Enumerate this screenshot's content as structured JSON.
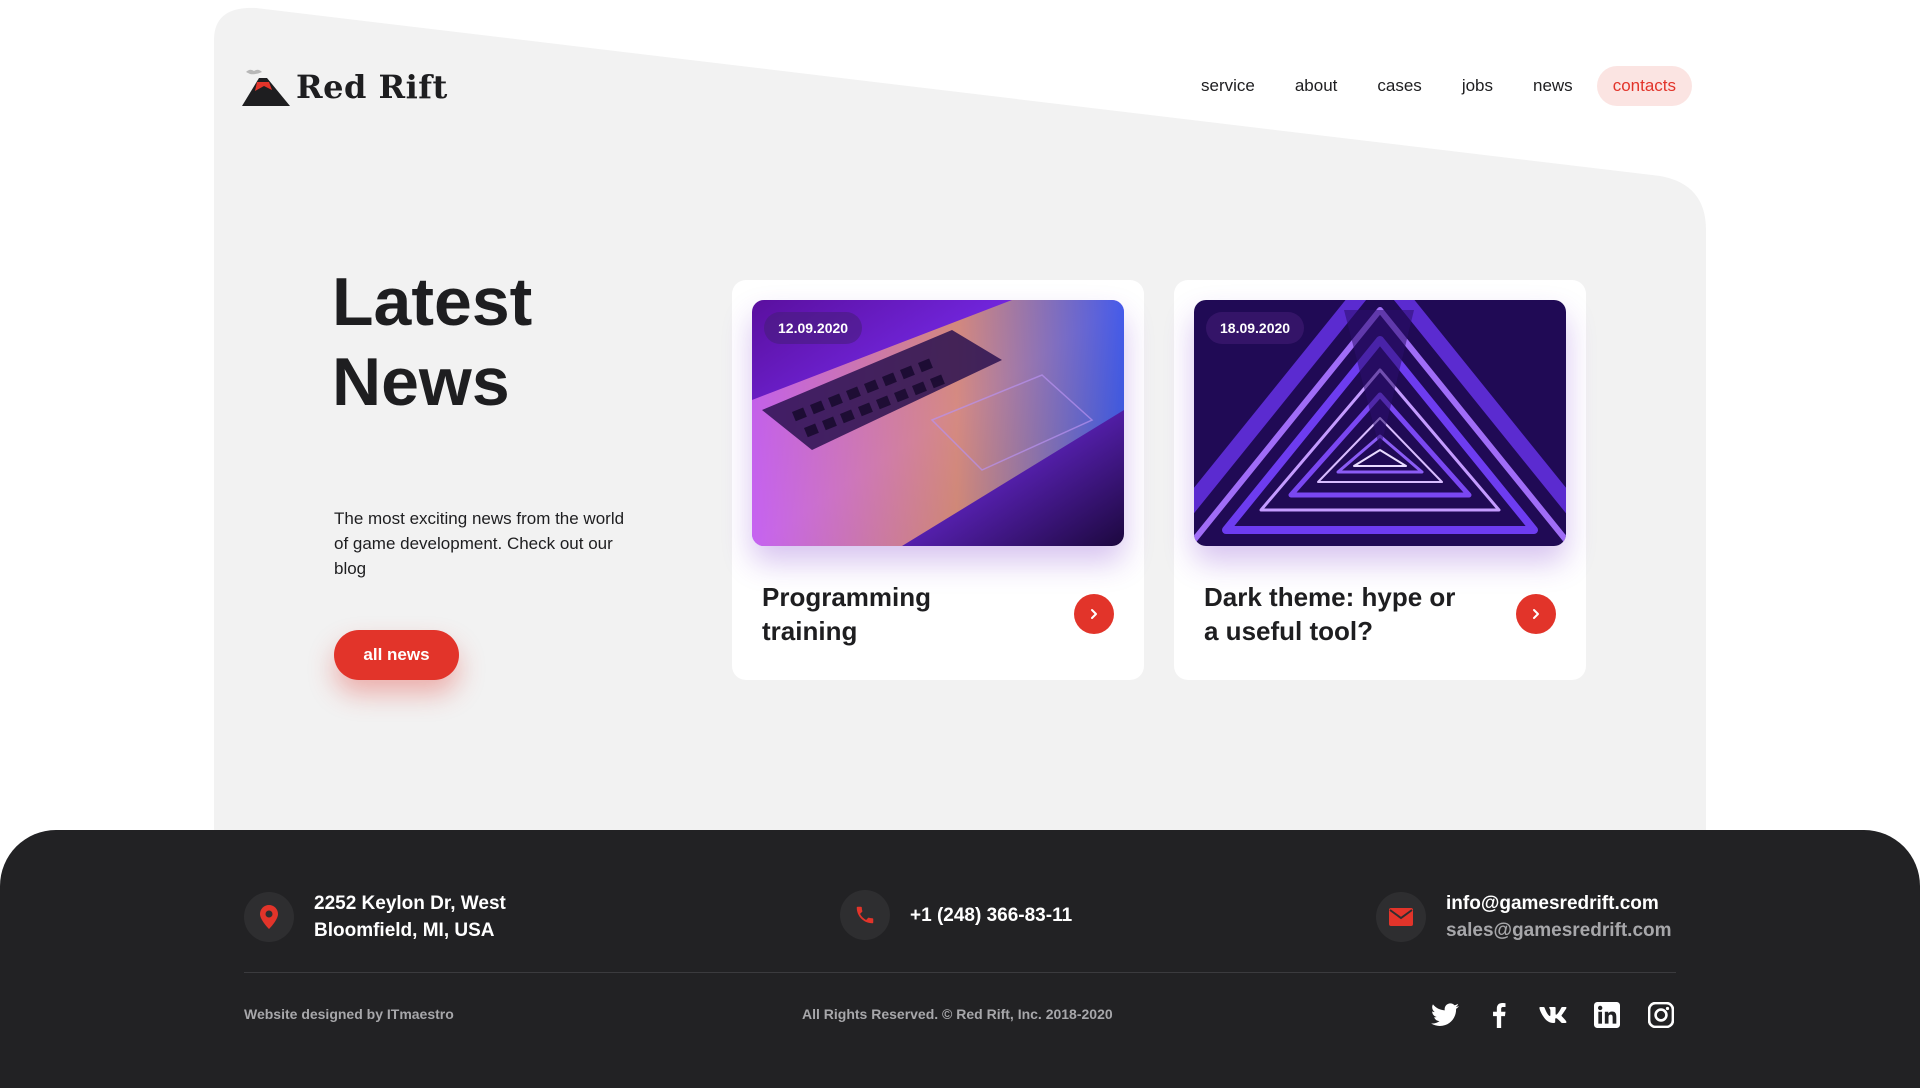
{
  "brand": {
    "name": "Red Rift",
    "accent": "#e2342a",
    "dark": "#1e1e20",
    "footer_bg": "#222224",
    "hero_bg": "#f2f2f2"
  },
  "nav": {
    "items": [
      {
        "label": "service",
        "active": false
      },
      {
        "label": "about",
        "active": false
      },
      {
        "label": "cases",
        "active": false
      },
      {
        "label": "jobs",
        "active": false
      },
      {
        "label": "news",
        "active": false
      },
      {
        "label": "contacts",
        "active": true
      }
    ]
  },
  "intro": {
    "title_line1": "Latest",
    "title_line2": "News",
    "description": "The most exciting news from the world of game development. Check out our blog",
    "button_label": "all news"
  },
  "cards": [
    {
      "date": "12.09.2020",
      "title": "Programming training",
      "image": "laptop-keyboard-image",
      "arrow_icon": "chevron-right-icon"
    },
    {
      "date": "18.09.2020",
      "title": "Dark theme: hype or a useful tool?",
      "image": "neon-triangle-tunnel-image",
      "arrow_icon": "chevron-right-icon"
    }
  ],
  "footer": {
    "address_line1": "2252 Keylon Dr, West",
    "address_line2": "Bloomfield, MI, USA",
    "phone": "+1 (248) 366-83-11",
    "email_primary": "info@gamesredrift.com",
    "email_secondary": "sales@gamesredrift.com",
    "designed_by": "Website designed by ITmaestro",
    "rights": "All Rights Reserved. © Red Rift, Inc. 2018-2020",
    "socials": [
      "twitter-icon",
      "facebook-icon",
      "vk-icon",
      "linkedin-icon",
      "instagram-icon"
    ],
    "contact_icons": [
      "location-pin-icon",
      "phone-icon",
      "envelope-icon"
    ]
  }
}
